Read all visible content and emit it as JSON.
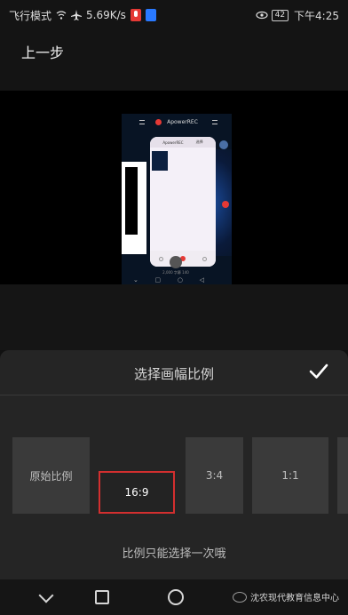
{
  "status_bar": {
    "airplane_mode": "飞行模式",
    "speed": "5.69K/s",
    "battery": "42",
    "time": "下午4:25",
    "icons": [
      "wifi-icon",
      "airplane-icon",
      "mic-icon",
      "shield-icon",
      "eye-icon",
      "battery-icon"
    ]
  },
  "header": {
    "back_label": "上一步"
  },
  "preview": {
    "app_title": "ApowerREC",
    "inner_title": "ApowerREC",
    "inner_action": "选择",
    "file_info": "2,000 字幕 140"
  },
  "sheet": {
    "title": "选择画幅比例",
    "confirm_icon": "check-icon",
    "options": [
      {
        "label": "原始比例"
      },
      {
        "label": "16:9"
      },
      {
        "label": "3:4"
      },
      {
        "label": "1:1"
      }
    ],
    "selected_option": "16:9",
    "hint": "比例只能选择一次哦",
    "accent_color": "#d32f2f"
  },
  "navbar": {
    "watermark": "沈农现代教育信息中心",
    "icons": [
      "back-icon",
      "recent-apps-icon",
      "home-icon"
    ]
  }
}
